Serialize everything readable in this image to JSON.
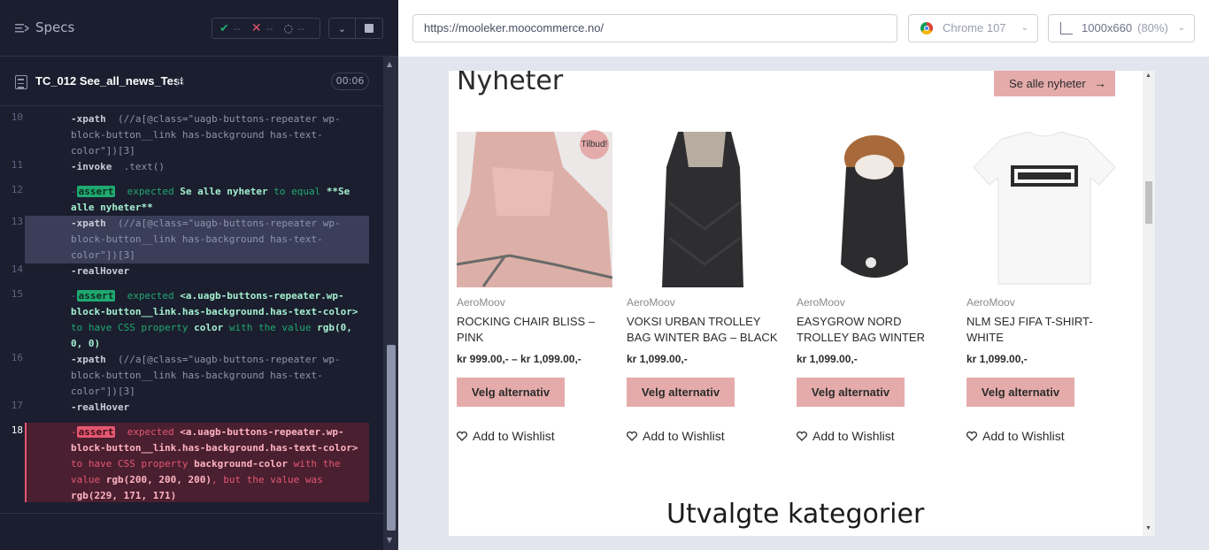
{
  "reporter": {
    "specs_label": "Specs",
    "stats": {
      "passed": "--",
      "failed": "--",
      "pending": "--"
    },
    "test_title": "TC_012 See_all_news_Test",
    "test_title_suffix": "js",
    "test_time": "00:06",
    "commands": [
      {
        "num": "10",
        "name": "-xpath",
        "args": "(//a[@class=\"uagb-buttons-repeater wp-block-button__link has-background has-text-color\"])[3]"
      },
      {
        "num": "11",
        "name": "-invoke",
        "args": ".text()"
      },
      {
        "num": "12",
        "type": "assert-pass",
        "label": "assert",
        "parts": [
          "expected",
          "Se alle nyheter",
          "to equal",
          "**Se alle nyheter**"
        ]
      },
      {
        "num": "13",
        "name": "-xpath",
        "args": "(//a[@class=\"uagb-buttons-repeater wp-block-button__link has-background has-text-color\"])[3]"
      },
      {
        "num": "14",
        "name": "-realHover",
        "args": ""
      },
      {
        "num": "15",
        "type": "assert-pass",
        "label": "assert",
        "parts": [
          "expected",
          "<a.uagb-buttons-repeater.wp-block-button__link.has-background.has-text-color>",
          "to have CSS property",
          "color",
          "with the value",
          "rgb(0, 0, 0)"
        ]
      },
      {
        "num": "16",
        "name": "-xpath",
        "args": "(//a[@class=\"uagb-buttons-repeater wp-block-button__link has-background has-text-color\"])[3]"
      },
      {
        "num": "17",
        "name": "-realHover",
        "args": ""
      },
      {
        "num": "18",
        "type": "assert-fail",
        "label": "assert",
        "parts": [
          "expected",
          "<a.uagb-buttons-repeater.wp-block-button__link.has-background.has-text-color>",
          "to have CSS property",
          "background-color",
          "with the value",
          "rgb(200, 200, 200)",
          ", but the value was",
          "rgb(229, 171, 171)"
        ]
      }
    ]
  },
  "browser": {
    "url": "https://mooleker.moocommerce.no/",
    "browser_name": "Chrome 107",
    "viewport": "1000x660",
    "zoom": "(80%)"
  },
  "site": {
    "section_title": "Nyheter",
    "see_all_label": "Se alle nyheter",
    "sale_badge": "Tilbud!",
    "products": [
      {
        "brand": "AeroMoov",
        "name": "ROCKING CHAIR BLISS – PINK",
        "price": "kr 999.00,- – kr 1,099.00,-",
        "button": "Velg alternativ",
        "wishlist": "Add to Wishlist"
      },
      {
        "brand": "AeroMoov",
        "name": "VOKSI URBAN TROLLEY BAG WINTER BAG – BLACK",
        "price": "kr 1,099.00,-",
        "button": "Velg alternativ",
        "wishlist": "Add to Wishlist"
      },
      {
        "brand": "AeroMoov",
        "name": "EASYGROW NORD TROLLEY BAG WINTER",
        "price": "kr 1,099.00,-",
        "button": "Velg alternativ",
        "wishlist": "Add to Wishlist"
      },
      {
        "brand": "AeroMoov",
        "name": "NLM SEJ FIFA T-SHIRT-WHITE",
        "price": "kr 1,099.00,-",
        "button": "Velg alternativ",
        "wishlist": "Add to Wishlist"
      }
    ],
    "next_section_title": "Utvalgte kategorier"
  },
  "colors": {
    "accent_pink": "#e5abab",
    "pass_green": "#1fa971",
    "fail_red": "#e45770",
    "panel_dark": "#1b1e2e"
  }
}
